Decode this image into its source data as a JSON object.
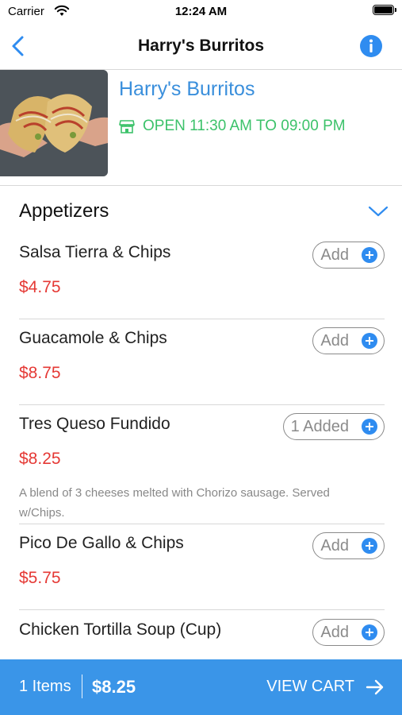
{
  "status_bar": {
    "carrier": "Carrier",
    "time": "12:24 AM"
  },
  "nav": {
    "title": "Harry's Burritos"
  },
  "restaurant": {
    "name": "Harry's Burritos",
    "hours": "OPEN 11:30 AM TO 09:00 PM",
    "hours_color": "#3cc26a",
    "name_color": "#3a8fdc"
  },
  "section": {
    "title": "Appetizers"
  },
  "items": [
    {
      "name": "Salsa Tierra & Chips",
      "price": "$4.75",
      "button": "Add"
    },
    {
      "name": "Guacamole & Chips",
      "price": "$8.75",
      "button": "Add"
    },
    {
      "name": "Tres Queso Fundido",
      "price": "$8.25",
      "button": "1 Added",
      "desc": "A blend of 3 cheeses melted with Chorizo sausage. Served w/Chips."
    },
    {
      "name": "Pico De Gallo & Chips",
      "price": "$5.75",
      "button": "Add"
    },
    {
      "name": "Chicken Tortilla Soup (Cup)",
      "price": "",
      "button": "Add"
    }
  ],
  "cart": {
    "count": "1 Items",
    "total": "$8.25",
    "view_label": "VIEW CART",
    "bar_color": "#3a95e8"
  },
  "colors": {
    "price": "#e53935",
    "accent": "#2f8cf0"
  }
}
